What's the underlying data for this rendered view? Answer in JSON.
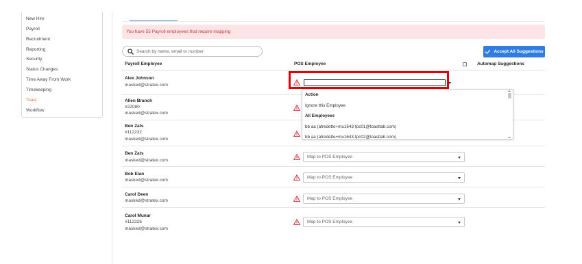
{
  "sidebar": {
    "items": [
      {
        "label": "New Hire",
        "active": false
      },
      {
        "label": "Payroll",
        "active": false
      },
      {
        "label": "Recruitment",
        "active": false
      },
      {
        "label": "Reporting",
        "active": false
      },
      {
        "label": "Security",
        "active": false
      },
      {
        "label": "Status Changes",
        "active": false
      },
      {
        "label": "Time Away From Work",
        "active": false
      },
      {
        "label": "Timekeeping",
        "active": false
      },
      {
        "label": "Toast",
        "active": true
      },
      {
        "label": "Workflow",
        "active": false
      }
    ]
  },
  "alert": {
    "text": "You have 55 Payroll employees that require mapping"
  },
  "search": {
    "placeholder": "Search by name, email or number"
  },
  "accept_all": {
    "label": "Accept All Suggestions"
  },
  "columns": {
    "payroll": "Payroll Employee",
    "pos": "POS Employee",
    "automap": "Automap Suggestions"
  },
  "select_placeholder": "Map to POS Employee",
  "rows": [
    {
      "name": "Alex Johnson",
      "number": "",
      "email": "masked@stratex.com"
    },
    {
      "name": "Allen Branch",
      "number": "#22080",
      "email": "masked@stratex.com"
    },
    {
      "name": "Ben Zats",
      "number": "#112232",
      "email": "masked@stratex.com"
    },
    {
      "name": "Ben Zats",
      "number": "",
      "email": "masked@stratex.com"
    },
    {
      "name": "Bob Elan",
      "number": "",
      "email": "masked@stratex.com"
    },
    {
      "name": "Carol Deen",
      "number": "",
      "email": "masked@stratex.com"
    },
    {
      "name": "Carol Munar",
      "number": "#112326",
      "email": "masked@stratex.com"
    }
  ],
  "dropdown": {
    "action_heading": "Action",
    "ignore_label": "Ignore this Employee",
    "all_heading": "All Employees",
    "options": [
      "bb aa (afredette+mu1643-tpc01@toasttab.com)",
      "bb aa (afredette+mu1643-tpc02@toasttab.com)"
    ]
  },
  "colors": {
    "accent": "#2f7de1",
    "active_nav": "#f26a3d",
    "alert_bg": "#fde4e6",
    "alert_text": "#cc3340",
    "warning": "#d9303a",
    "highlight": "#e20000"
  }
}
